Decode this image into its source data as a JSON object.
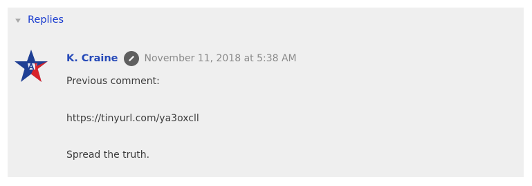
{
  "replies": {
    "label": "Replies",
    "toggle_icon": "triangle-down-icon"
  },
  "comment": {
    "author": "K. Craine",
    "author_badge_icon": "pencil-icon",
    "timestamp": "November 11, 2018 at 5:38 AM",
    "avatar_icon": "star-avatar-icon",
    "body": {
      "line1": "Previous comment:",
      "line2": "https://tinyurl.com/ya3oxcll",
      "line3": "Spread the truth."
    }
  },
  "colors": {
    "panel_bg": "#efefef",
    "link": "#1a3ccf",
    "author": "#2549b8",
    "timestamp": "#8a8a8a",
    "body_text": "#3c3c3c",
    "badge": "#5f5f5f",
    "avatar_blue": "#1f3f94",
    "avatar_red": "#d8232a"
  }
}
